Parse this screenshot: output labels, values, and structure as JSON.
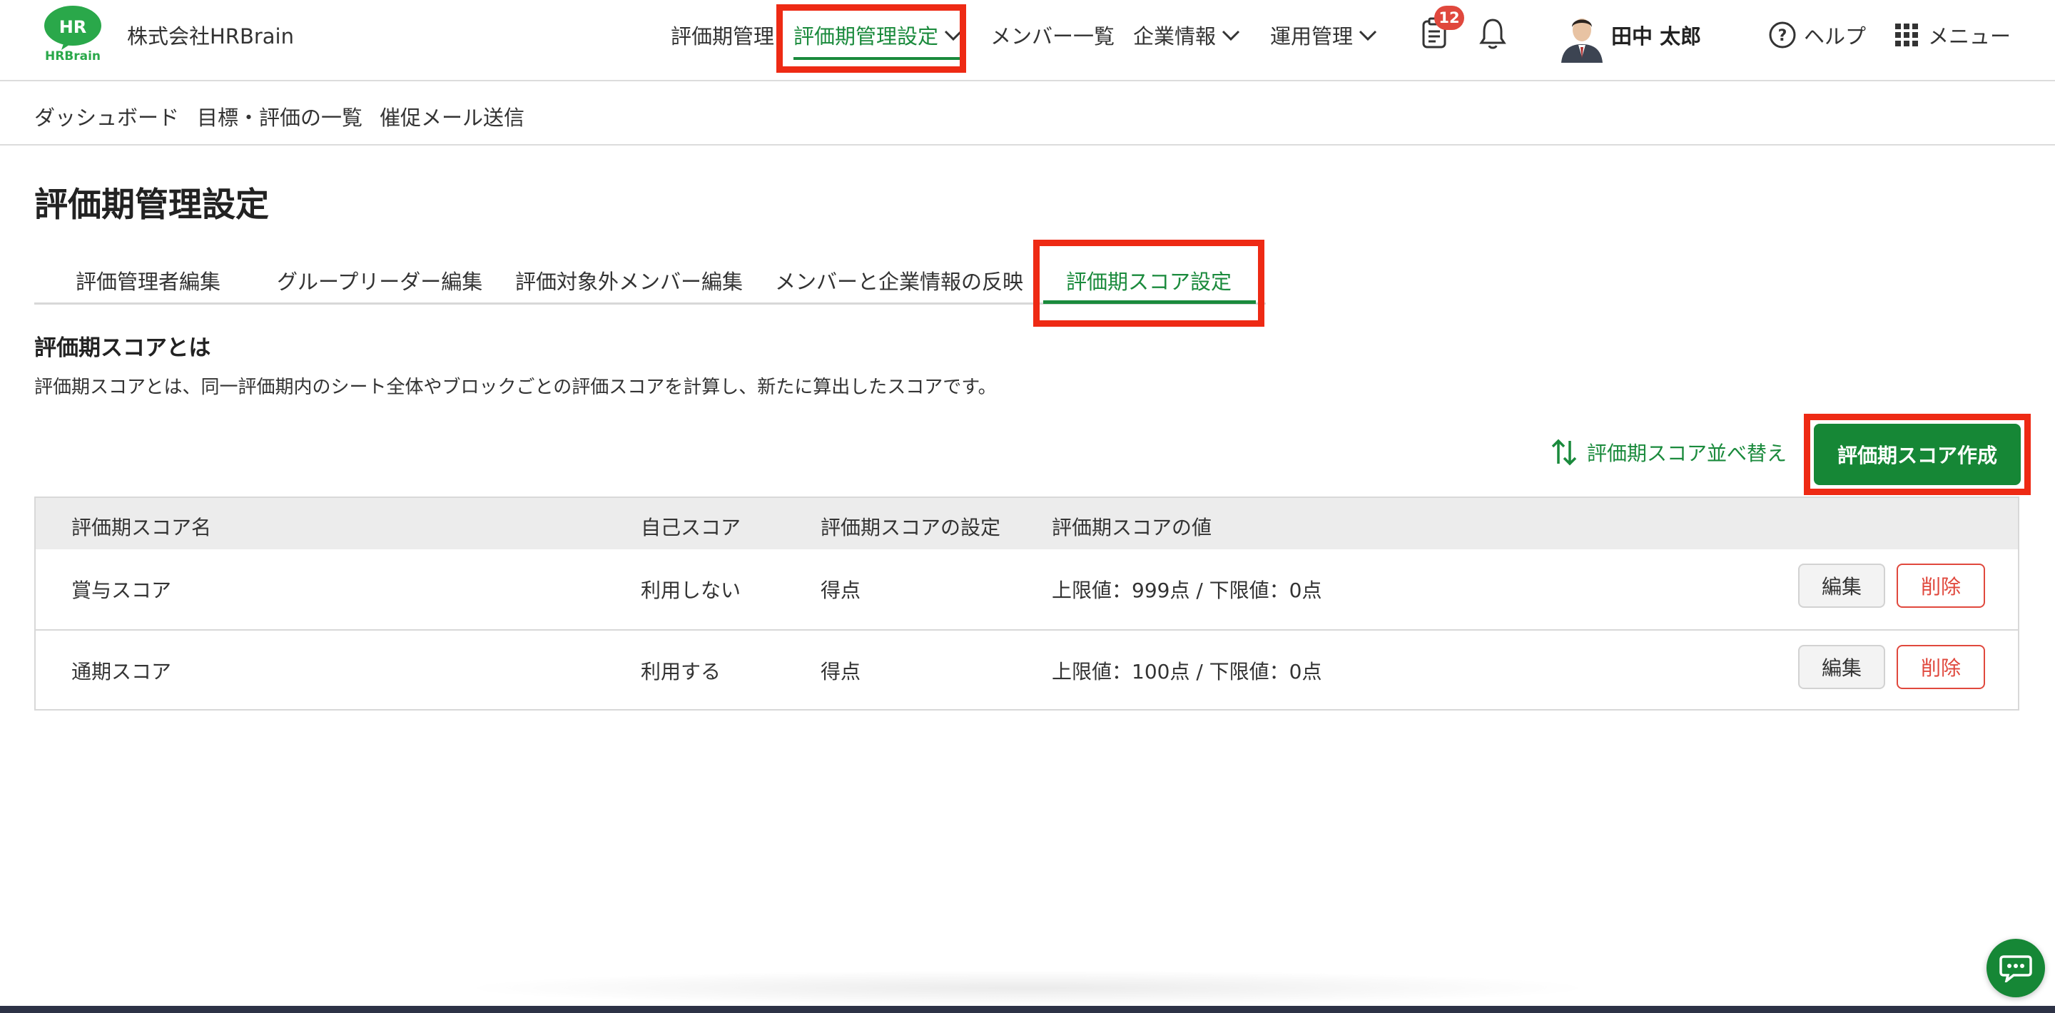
{
  "header": {
    "company_name": "株式会社HRBrain",
    "logo": {
      "badge_text": "HR",
      "wordmark": "HRBrain"
    },
    "nav": [
      {
        "label": "評価期管理"
      },
      {
        "label": "評価期管理設定",
        "active": true
      },
      {
        "label": "メンバー一覧"
      },
      {
        "label": "企業情報"
      },
      {
        "label": "運用管理"
      }
    ],
    "notification_count": "12",
    "user_name": "田中 太郎",
    "help_label": "ヘルプ",
    "menu_label": "メニュー"
  },
  "subnav": [
    {
      "label": "ダッシュボード"
    },
    {
      "label": "目標・評価の一覧"
    },
    {
      "label": "催促メール送信"
    }
  ],
  "page_title": "評価期管理設定",
  "tabs": [
    {
      "label": "評価管理者編集"
    },
    {
      "label": "グループリーダー編集"
    },
    {
      "label": "評価対象外メンバー編集"
    },
    {
      "label": "メンバーと企業情報の反映"
    },
    {
      "label": "評価期スコア設定",
      "active": true
    }
  ],
  "section": {
    "title": "評価期スコアとは",
    "description": "評価期スコアとは、同一評価期内のシート全体やブロックごとの評価スコアを計算し、新たに算出したスコアです。"
  },
  "actions": {
    "sort_label": "評価期スコア並べ替え",
    "create_label": "評価期スコア作成"
  },
  "table": {
    "columns": [
      "評価期スコア名",
      "自己スコア",
      "評価期スコアの設定",
      "評価期スコアの値"
    ],
    "rows": [
      {
        "name": "賞与スコア",
        "self_score": "利用しない",
        "setting": "得点",
        "value": "上限値：999点 / 下限値：0点",
        "edit": "編集",
        "delete": "削除"
      },
      {
        "name": "通期スコア",
        "self_score": "利用する",
        "setting": "得点",
        "value": "上限値：100点 / 下限値：0点",
        "edit": "編集",
        "delete": "削除"
      }
    ]
  },
  "colors": {
    "brand_green": "#168736",
    "active_green": "#1a8a3c",
    "highlight_red": "#ee2a14",
    "delete_red": "#e0483d"
  },
  "icons": [
    "chevron-down-icon",
    "clipboard-icon",
    "bell-icon",
    "help-circle-icon",
    "grid-menu-icon",
    "sort-arrows-icon",
    "chat-icon"
  ]
}
